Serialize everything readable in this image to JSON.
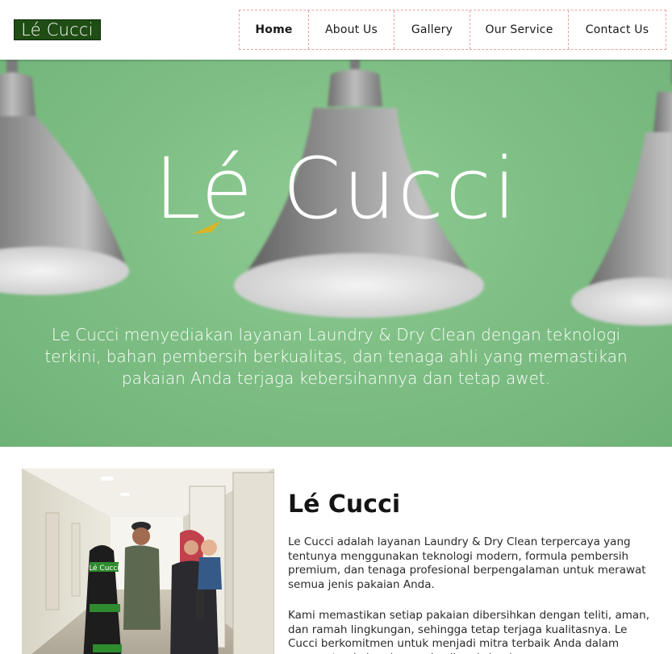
{
  "brand": {
    "logo_text": "Lé Cucci",
    "color": "#1f4d14"
  },
  "nav": {
    "items": [
      {
        "label": "Home",
        "active": true
      },
      {
        "label": "About Us"
      },
      {
        "label": "Gallery"
      },
      {
        "label": "Our Service"
      },
      {
        "label": "Contact Us"
      }
    ],
    "border_color": "#e8a4a4"
  },
  "hero": {
    "logo_text": "Lé Cucci",
    "tagline": "Le Cucci menyediakan layanan Laundry & Dry Clean dengan teknologi terkini, bahan pembersih berkualitas, dan tenaga ahli yang memastikan pakaian Anda terjaga kebersihannya dan tetap awet.",
    "background_color": "#7fbf85",
    "accent_color": "#d9b526"
  },
  "photo": {
    "garment_tag": "Lé Cucci"
  },
  "about": {
    "title": "Lé Cucci",
    "paragraph_1": "Le Cucci adalah layanan Laundry & Dry Clean terpercaya yang tentunya menggunakan teknologi modern, formula pembersih premium, dan tenaga profesional berpengalaman untuk merawat semua jenis pakaian Anda.",
    "paragraph_2": "Kami memastikan setiap pakaian dibersihkan dengan teliti, aman, dan ramah lingkungan, sehingga tetap terjaga kualitasnya. Le Cucci berkomitmen untuk menjadi mitra terbaik Anda dalam merawat pakaian dengan hasil maksimal."
  }
}
